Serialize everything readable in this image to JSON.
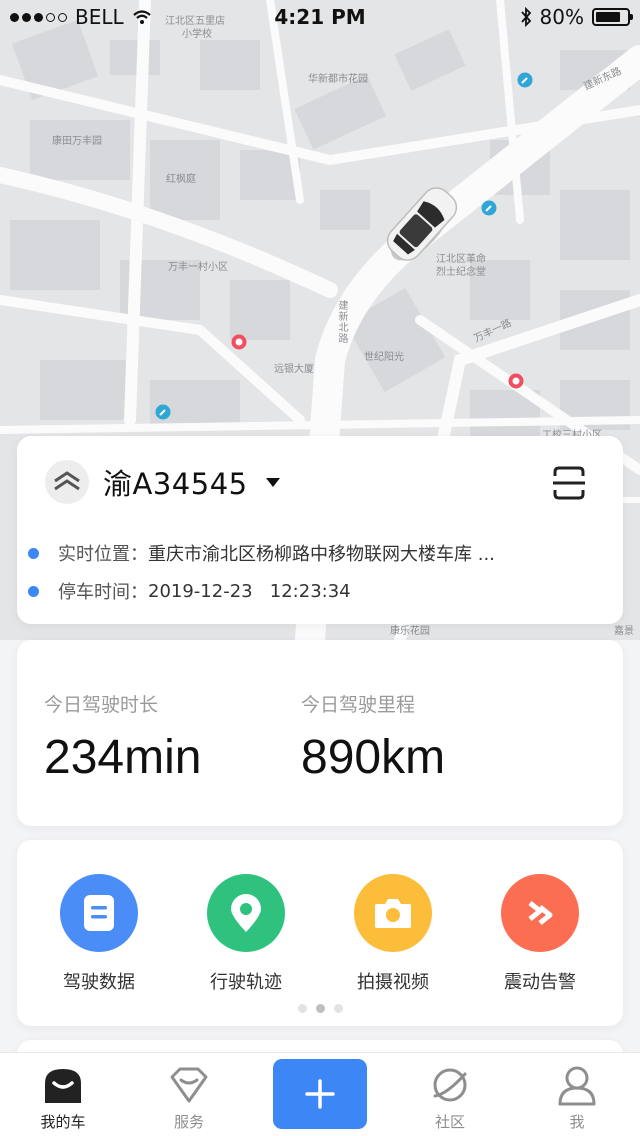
{
  "status_bar": {
    "carrier": "BELL",
    "time": "4:21 PM",
    "battery": "80%",
    "battery_level": 0.8
  },
  "map": {
    "labels": [
      "江北区五里店",
      "小学校",
      "华新都市花园",
      "建新东路",
      "康田万丰园",
      "红枫庭",
      "万丰一村小区",
      "江北区革命",
      "烈士纪念堂",
      "建新北路",
      "世纪阳光",
      "远银大厦",
      "万丰一路",
      "工校三村小区",
      "康乐花园",
      "嘉景"
    ],
    "icons": [
      "car-marker-icon",
      "hospital-icon",
      "hospital-icon",
      "wrench-poi-icon",
      "wrench-poi-icon",
      "wrench-poi-icon"
    ]
  },
  "vehicle": {
    "plate": "渝A34545",
    "location_label": "实时位置：",
    "location_value": "重庆市渝北区杨柳路中移物联网大楼车库 ...",
    "parking_label": "停车时间：",
    "parking_value": "2019-12-23   12:23:34",
    "accent_color": "#3d86f5"
  },
  "stats": {
    "duration_label": "今日驾驶时长",
    "duration_value": "234min",
    "mileage_label": "今日驾驶里程",
    "mileage_value": "890km"
  },
  "functions": [
    {
      "label": "驾驶数据",
      "icon": "document-icon",
      "color": "#4a8df6"
    },
    {
      "label": "行驶轨迹",
      "icon": "location-pin-icon",
      "color": "#2ec27e"
    },
    {
      "label": "拍摄视频",
      "icon": "camera-icon",
      "color": "#fbbd3a"
    },
    {
      "label": "震动告警",
      "icon": "vibration-alert-icon",
      "color": "#fb6e52"
    }
  ],
  "pagination": {
    "pages": 3,
    "active": 2
  },
  "tabbar": {
    "tabs": [
      {
        "label": "我的车",
        "icon": "car-icon",
        "active": true
      },
      {
        "label": "服务",
        "icon": "service-icon",
        "active": false
      },
      {
        "label": "社区",
        "icon": "planet-icon",
        "active": false
      },
      {
        "label": "我",
        "icon": "user-icon",
        "active": false
      }
    ],
    "plus_icon": "plus-icon"
  }
}
